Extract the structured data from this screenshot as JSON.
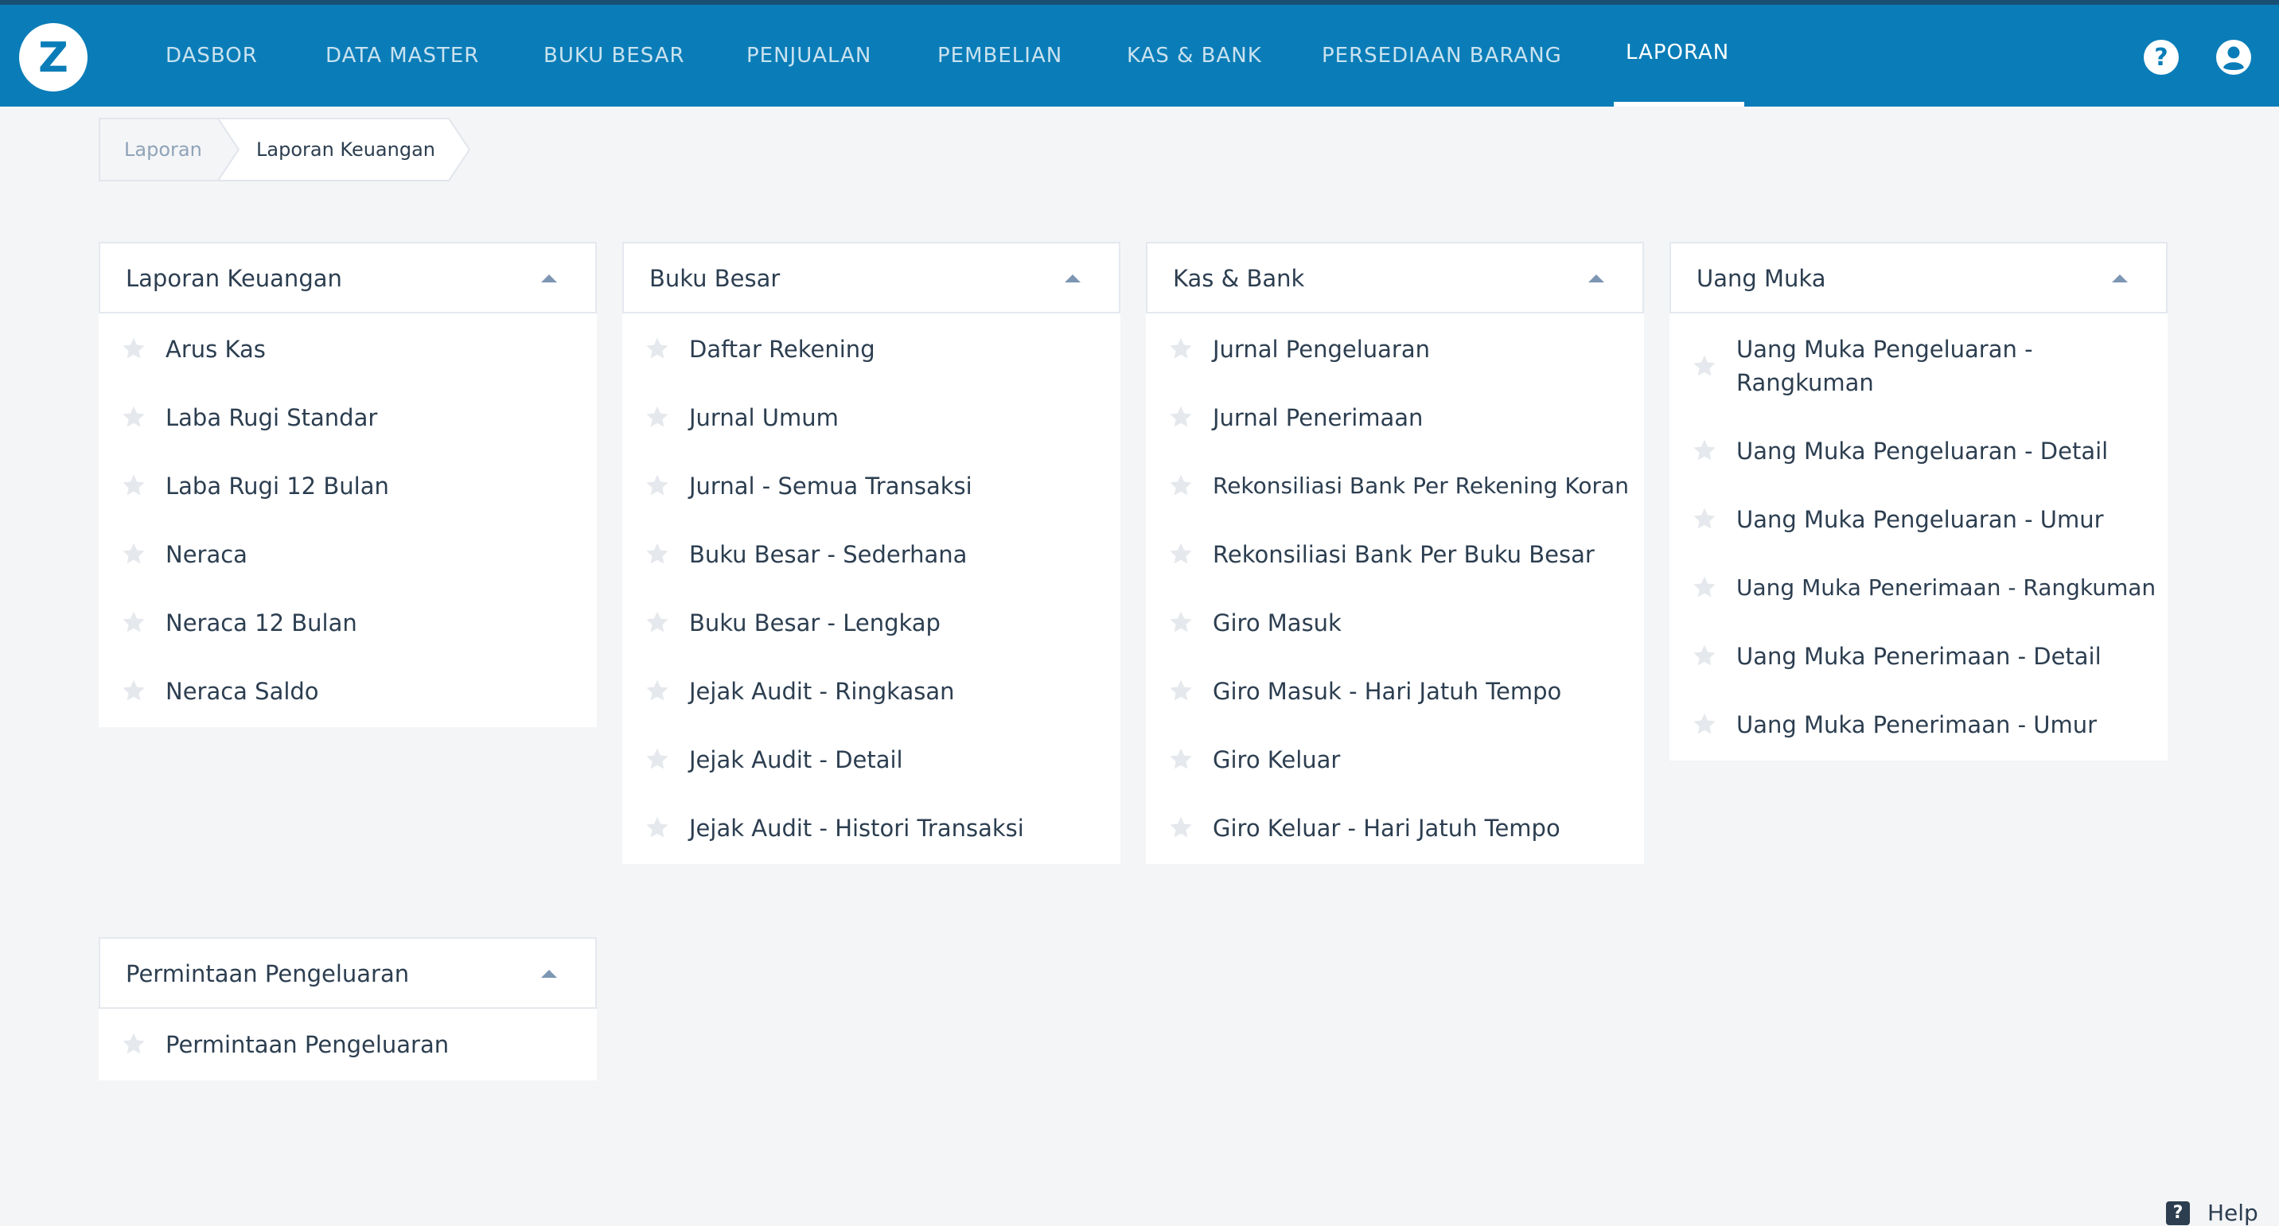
{
  "app": {
    "logo_letter": "Z",
    "brand_color": "#0a7db8"
  },
  "nav": {
    "items": [
      {
        "label": "DASBOR"
      },
      {
        "label": "DATA MASTER"
      },
      {
        "label": "BUKU BESAR"
      },
      {
        "label": "PENJUALAN"
      },
      {
        "label": "PEMBELIAN"
      },
      {
        "label": "KAS & BANK"
      },
      {
        "label": "PERSEDIAAN BARANG"
      },
      {
        "label": "LAPORAN"
      }
    ],
    "active": "LAPORAN"
  },
  "topbar_icons": [
    "help-icon",
    "account-icon"
  ],
  "breadcrumb": [
    "Laporan",
    "Laporan Keuangan"
  ],
  "cards": [
    {
      "title": "Laporan Keuangan",
      "items": [
        "Arus Kas",
        "Laba Rugi Standar",
        "Laba Rugi 12 Bulan",
        "Neraca",
        "Neraca 12 Bulan",
        "Neraca Saldo"
      ]
    },
    {
      "title": "Buku Besar",
      "items": [
        "Daftar Rekening",
        "Jurnal Umum",
        "Jurnal - Semua Transaksi",
        "Buku Besar - Sederhana",
        "Buku Besar - Lengkap",
        "Jejak Audit - Ringkasan",
        "Jejak Audit - Detail",
        "Jejak Audit - Histori Transaksi"
      ]
    },
    {
      "title": "Kas & Bank",
      "items": [
        "Jurnal Pengeluaran",
        "Jurnal Penerimaan",
        "Rekonsiliasi Bank Per Rekening Koran",
        "Rekonsiliasi Bank Per Buku Besar",
        "Giro Masuk",
        "Giro Masuk - Hari Jatuh Tempo",
        "Giro Keluar",
        "Giro Keluar - Hari Jatuh Tempo"
      ]
    },
    {
      "title": "Uang Muka",
      "items": [
        "Uang Muka Pengeluaran - Rangkuman",
        "Uang Muka Pengeluaran - Detail",
        "Uang Muka Pengeluaran - Umur",
        "Uang Muka Penerimaan - Rangkuman",
        "Uang Muka Penerimaan - Detail",
        "Uang Muka Penerimaan - Umur"
      ]
    },
    {
      "title": "Permintaan Pengeluaran",
      "items": [
        "Permintaan Pengeluaran"
      ]
    }
  ],
  "help_button": {
    "icon": "?",
    "label": "Help"
  }
}
